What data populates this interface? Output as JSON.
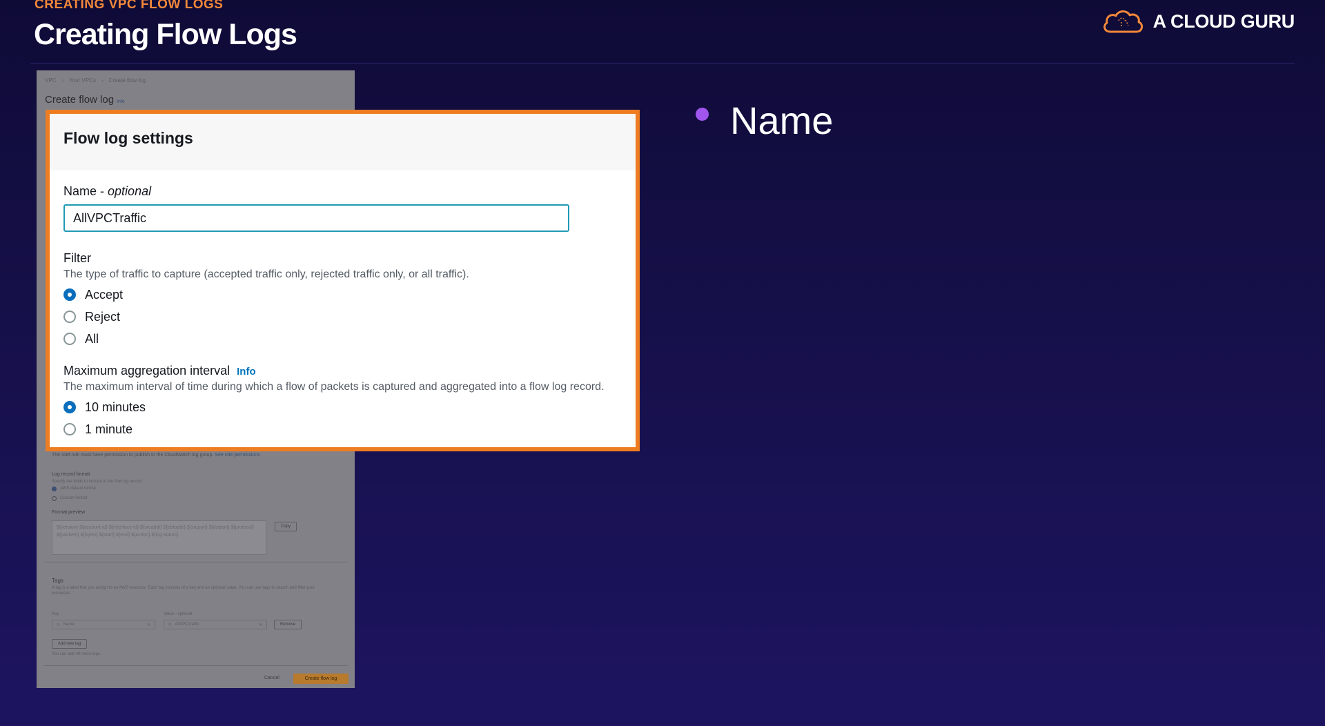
{
  "slide": {
    "eyebrow": "CREATING VPC FLOW LOGS",
    "title": "Creating Flow Logs",
    "brand": "A CLOUD GURU"
  },
  "background_screenshot": {
    "breadcrumbs": [
      "VPC",
      "Your VPCs",
      "Create flow log"
    ],
    "title": "Create flow log",
    "title_info": "Info",
    "iam_note": "The IAM role must have permission to publish to the CloudWatch log group.",
    "iam_note_link": "See role permissions",
    "log_record_format_label": "Log record format",
    "log_record_format_desc": "Specify the fields to include in the flow log record.",
    "log_record_options": [
      "AWS default format",
      "Custom format"
    ],
    "format_preview_label": "Format preview",
    "format_preview_text": "${version} ${account-id} ${interface-id} ${srcaddr} ${dstaddr} ${srcport} ${dstport} ${protocol} ${packets} ${bytes} ${start} ${end} ${action} ${log-status}",
    "copy_button": "Copy",
    "tags_label": "Tags",
    "tags_desc": "A tag is a label that you assign to an AWS resource. Each tag consists of a key and an optional value. You can use tags to search and filter your resources.",
    "tag_key_label": "Key",
    "tag_value_label": "Value - optional",
    "tag_key_value": "Name",
    "tag_value_value": "AllVPCTraffic",
    "remove_button": "Remove",
    "add_tag_button": "Add new tag",
    "tag_limit_note": "You can add 49 more tags.",
    "cancel_button": "Cancel",
    "create_button": "Create flow log"
  },
  "panel": {
    "title": "Flow log settings",
    "name_label": "Name -",
    "name_optional": "optional",
    "name_value": "AllVPCTraffic",
    "filter_label": "Filter",
    "filter_desc": "The type of traffic to capture (accepted traffic only, rejected traffic only, or all traffic).",
    "filter_options": [
      "Accept",
      "Reject",
      "All"
    ],
    "filter_selected": "Accept",
    "interval_label": "Maximum aggregation interval",
    "interval_info": "Info",
    "interval_desc": "The maximum interval of time during which a flow of packets is captured and aggregated into a flow log record.",
    "interval_options": [
      "10 minutes",
      "1 minute"
    ],
    "interval_selected": "10 minutes"
  },
  "bullets": [
    "Name"
  ],
  "colors": {
    "accent_orange": "#ee7d22",
    "eyebrow_orange": "#f3883a",
    "bullet_purple": "#a155ef",
    "radio_selected": "#0a6ebd",
    "input_focus": "#1f9ab5",
    "info_link": "#0073bb"
  }
}
